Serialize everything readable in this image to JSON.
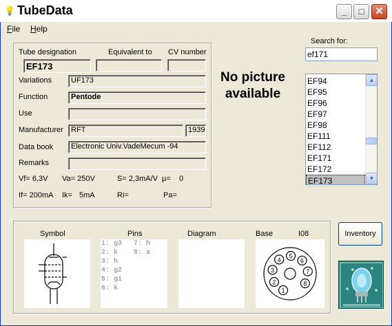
{
  "window": {
    "title": "TubeData",
    "controls": {
      "minimize": "_",
      "maximize": "□",
      "close": "✕"
    }
  },
  "menu": {
    "file": {
      "underline": "F",
      "rest": "ile"
    },
    "help": {
      "underline": "H",
      "rest": "elp"
    }
  },
  "tube": {
    "designation_label": "Tube designation",
    "equivalent_label": "Equivalent to",
    "cv_label": "CV number",
    "designation": "EF173",
    "equivalent": "",
    "cv_number": "",
    "variations_label": "Variations",
    "variations": "UF173",
    "function_label": "Function",
    "function": "Pentode",
    "use_label": "Use",
    "use": "",
    "manufacturer_label": "Manufacturer",
    "manufacturer": "RFT",
    "year": "1939",
    "databook_label": "Data book",
    "databook": "Electronic Univ.VadeMecum -94",
    "remarks_label": "Remarks",
    "remarks": ""
  },
  "params": {
    "vf": "Vf= 6,3V",
    "va": "Va= 250V",
    "s": "S= 2,3mA/V",
    "mu": "µ=",
    "mu_value": "0",
    "if": "If= 200mA",
    "ik": "Ik=",
    "ik_value": "5mA",
    "ri": "Ri=",
    "pa": "Pa="
  },
  "picture": {
    "message": "No picture available"
  },
  "search": {
    "label": "Search for:",
    "value": "ef171"
  },
  "list": {
    "items": [
      "EF94",
      "EF95",
      "EF96",
      "EF97",
      "EF98",
      "EF111",
      "EF112",
      "EF171",
      "EF172",
      "EF173"
    ],
    "selected_index": 9,
    "scroll_up": "▲",
    "scroll_down": "▼"
  },
  "bottom": {
    "symbol_label": "Symbol",
    "pins_label": "Pins",
    "diagram_label": "Diagram",
    "base_label": "Base",
    "base_type": "I08",
    "pins_col1": [
      "1: g3",
      "2: k",
      "3: h",
      "4: g2",
      "5: g1",
      "6: k"
    ],
    "pins_col2": [
      "7: h",
      "8: a"
    ],
    "base_pin_numbers": [
      "1",
      "2",
      "3",
      "4",
      "5",
      "6",
      "7",
      "8"
    ]
  },
  "inventory_button": "Inventory",
  "icons": {
    "title": "bulb-icon",
    "logo": "tube-logo-icon"
  },
  "colors": {
    "window_bg": "#ece9d8",
    "close_button": "#c4441f",
    "logo_bg": "#1f6f6d"
  }
}
